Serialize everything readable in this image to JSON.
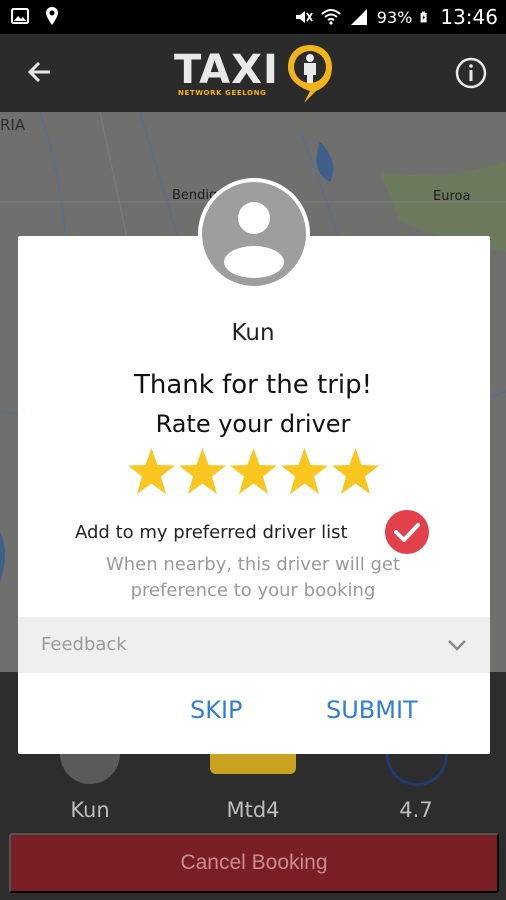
{
  "status_bar": {
    "battery_percent": "93%",
    "time": "13:46",
    "icons": [
      "image-icon",
      "location-icon",
      "mute-icon",
      "wifi-icon",
      "signal-icon",
      "battery-charging-icon"
    ]
  },
  "app_bar": {
    "logo_text": "TAXI",
    "logo_subtext": "NETWORK GEELONG",
    "back_icon": "arrow-back-icon",
    "info_icon": "info-icon"
  },
  "map": {
    "labels": [
      "RIA",
      "Bendig",
      "Euroa"
    ]
  },
  "bottom_panel": {
    "driver_name": "Kun",
    "vehicle": "Mtd4",
    "rating": "4.7",
    "cancel_label": "Cancel Booking"
  },
  "dialog": {
    "driver_name": "Kun",
    "thanks": "Thank for the trip!",
    "rate_prompt": "Rate your driver",
    "stars_total": 5,
    "stars_selected": 5,
    "preferred_label": "Add to my preferred driver list",
    "preferred_checked": true,
    "preferred_note": "When nearby, this driver will get preference to your booking",
    "feedback_label": "Feedback",
    "skip_label": "SKIP",
    "submit_label": "SUBMIT"
  },
  "colors": {
    "accent_blue": "#2f7fd6",
    "star_yellow": "#f9c61f",
    "check_red": "#e2404b",
    "logo_yellow": "#f3b31a",
    "cancel_red": "#7a1e26"
  }
}
